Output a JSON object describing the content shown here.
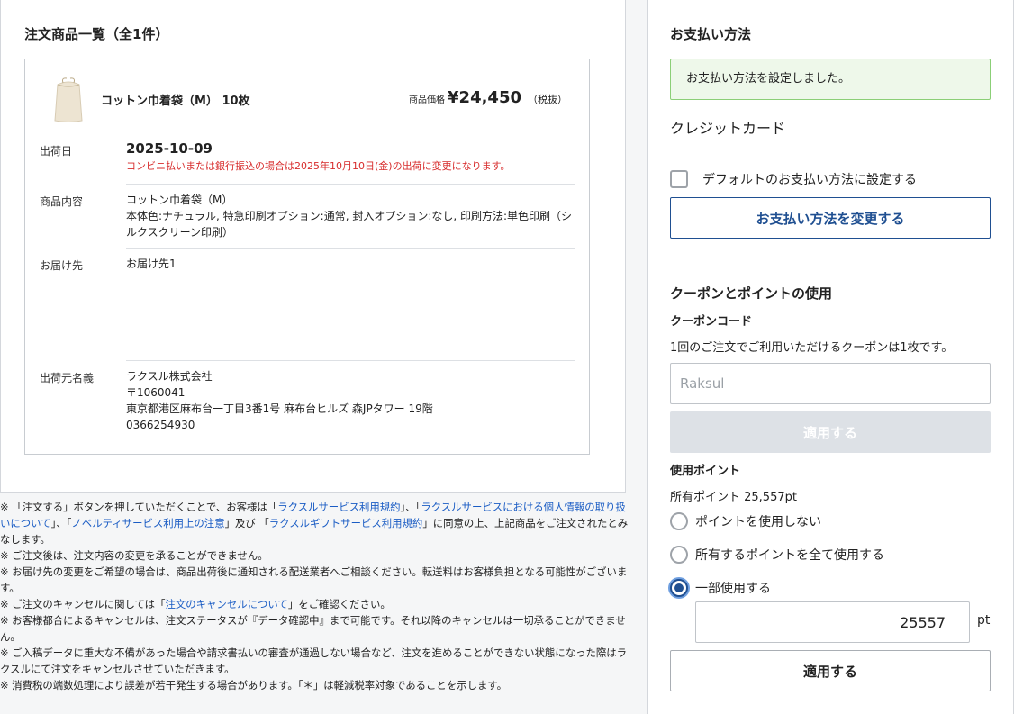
{
  "order_list": {
    "title": "注文商品一覧（全1件）",
    "product": {
      "name": "コットン巾着袋（M）  10枚",
      "price_label": "商品価格",
      "price": "¥24,450",
      "tax_note": "（税抜）"
    },
    "rows": {
      "ship_date": {
        "label": "出荷日",
        "date": "2025-10-09",
        "warning": "コンビニ払いまたは銀行振込の場合は2025年10月10日(金)の出荷に変更になります。"
      },
      "contents": {
        "label": "商品内容",
        "line1": "コットン巾着袋（M）",
        "line2": "本体色:ナチュラル, 特急印刷オプション:通常, 封入オプション:なし, 印刷方法:単色印刷（シルクスクリーン印刷）"
      },
      "destination": {
        "label": "お届け先",
        "value": "お届け先1"
      },
      "sender": {
        "label": "出荷元名義",
        "company": "ラクスル株式会社",
        "zip": "〒1060041",
        "address": "東京都港区麻布台一丁目3番1号 麻布台ヒルズ 森JPタワー 19階",
        "phone": "0366254930"
      }
    }
  },
  "notes": {
    "n1_a": "※ 「注文する」ボタンを押していただくことで、お客様は「",
    "n1_link1": "ラクスルサービス利用規約",
    "n1_b": "」、「",
    "n1_link2": "ラクスルサービスにおける個人情報の取り扱いについて",
    "n1_c": "」、「",
    "n1_link3": "ノベルティサービス利用上の注意",
    "n1_d": "」及び 「",
    "n1_link4": "ラクスルギフトサービス利用規約",
    "n1_e": "」に同意の上、上記商品をご注文されたとみなします。",
    "n2": "※ ご注文後は、注文内容の変更を承ることができません。",
    "n3": "※ お届け先の変更をご希望の場合は、商品出荷後に通知される配送業者へご相談ください。転送料はお客様負担となる可能性がございます。",
    "n4_a": "※ ご注文のキャンセルに関しては「",
    "n4_link": "注文のキャンセルについて",
    "n4_b": "」をご確認ください。",
    "n5": "※ お客様都合によるキャンセルは、注文ステータスが『データ確認中』まで可能です。それ以降のキャンセルは一切承ることができません。",
    "n6": "※ ご入稿データに重大な不備があった場合や請求書払いの審査が通過しない場合など、注文を進めることができない状態になった際はラクスルにて注文をキャンセルさせていただきます。",
    "n7": "※ 消費税の端数処理により誤差が若干発生する場合があります。「＊」は軽減税率対象であることを示します。"
  },
  "payment": {
    "title": "お支払い方法",
    "success_message": "お支払い方法を設定しました。",
    "method": "クレジットカード",
    "default_checkbox_label": "デフォルトのお支払い方法に設定する",
    "change_button": "お支払い方法を変更する"
  },
  "coupon": {
    "section_title": "クーポンとポイントの使用",
    "code_label": "クーポンコード",
    "note": "1回のご注文でご利用いただけるクーポンは1枚です。",
    "placeholder": "Raksul",
    "apply_button": "適用する"
  },
  "points": {
    "label": "使用ポイント",
    "owned": "所有ポイント 25,557pt",
    "options": [
      {
        "label": "ポイントを使用しない"
      },
      {
        "label": "所有するポイントを全て使用する"
      },
      {
        "label": "一部使用する"
      }
    ],
    "selected_index": 2,
    "value": "25557",
    "unit": "pt",
    "apply_button": "適用する"
  }
}
